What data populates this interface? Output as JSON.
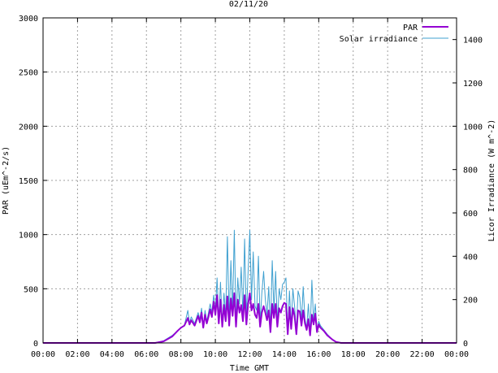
{
  "chart_data": {
    "type": "line",
    "title": "02/11/20",
    "xlabel": "Time GMT",
    "ylabel_left": "PAR (uEm^-2/s)",
    "ylabel_right": "Licor Irradiance (W m^-2)",
    "x_tick_labels": [
      "00:00",
      "02:00",
      "04:00",
      "06:00",
      "08:00",
      "10:00",
      "12:00",
      "14:00",
      "16:00",
      "18:00",
      "20:00",
      "22:00",
      "00:00"
    ],
    "x_range_hours": [
      0,
      24
    ],
    "y_left_range": [
      0,
      3000
    ],
    "y_left_ticks": [
      0,
      500,
      1000,
      1500,
      2000,
      2500,
      3000
    ],
    "y_right_range": [
      0,
      1500
    ],
    "y_right_ticks": [
      0,
      200,
      400,
      600,
      800,
      1000,
      1200,
      1400
    ],
    "grid": true,
    "legend_position": "top-right",
    "series": [
      {
        "name": "PAR",
        "axis": "left",
        "color": "#9400d3",
        "points": [
          [
            0,
            0
          ],
          [
            6.5,
            0
          ],
          [
            7.0,
            15
          ],
          [
            7.5,
            60
          ],
          [
            7.8,
            110
          ],
          [
            8.0,
            140
          ],
          [
            8.2,
            160
          ],
          [
            8.4,
            230
          ],
          [
            8.5,
            170
          ],
          [
            8.6,
            210
          ],
          [
            8.8,
            160
          ],
          [
            9.0,
            250
          ],
          [
            9.1,
            190
          ],
          [
            9.2,
            280
          ],
          [
            9.3,
            140
          ],
          [
            9.4,
            260
          ],
          [
            9.5,
            180
          ],
          [
            9.6,
            240
          ],
          [
            9.7,
            310
          ],
          [
            9.8,
            240
          ],
          [
            9.9,
            380
          ],
          [
            10.0,
            260
          ],
          [
            10.1,
            440
          ],
          [
            10.2,
            180
          ],
          [
            10.3,
            400
          ],
          [
            10.4,
            150
          ],
          [
            10.5,
            350
          ],
          [
            10.6,
            200
          ],
          [
            10.7,
            430
          ],
          [
            10.8,
            160
          ],
          [
            10.9,
            410
          ],
          [
            11.0,
            250
          ],
          [
            11.1,
            460
          ],
          [
            11.2,
            150
          ],
          [
            11.3,
            400
          ],
          [
            11.4,
            280
          ],
          [
            11.5,
            350
          ],
          [
            11.6,
            200
          ],
          [
            11.7,
            440
          ],
          [
            11.8,
            170
          ],
          [
            11.9,
            360
          ],
          [
            12.0,
            460
          ],
          [
            12.1,
            300
          ],
          [
            12.2,
            360
          ],
          [
            12.3,
            260
          ],
          [
            12.4,
            230
          ],
          [
            12.5,
            360
          ],
          [
            12.6,
            150
          ],
          [
            12.7,
            280
          ],
          [
            12.8,
            340
          ],
          [
            12.9,
            280
          ],
          [
            13.0,
            210
          ],
          [
            13.1,
            300
          ],
          [
            13.2,
            100
          ],
          [
            13.3,
            360
          ],
          [
            13.4,
            230
          ],
          [
            13.5,
            360
          ],
          [
            13.6,
            150
          ],
          [
            13.7,
            320
          ],
          [
            13.8,
            280
          ],
          [
            13.9,
            340
          ],
          [
            14.0,
            370
          ],
          [
            14.1,
            360
          ],
          [
            14.2,
            80
          ],
          [
            14.3,
            330
          ],
          [
            14.4,
            130
          ],
          [
            14.5,
            320
          ],
          [
            14.6,
            250
          ],
          [
            14.7,
            80
          ],
          [
            14.8,
            300
          ],
          [
            14.9,
            290
          ],
          [
            15.0,
            160
          ],
          [
            15.1,
            300
          ],
          [
            15.2,
            180
          ],
          [
            15.3,
            120
          ],
          [
            15.4,
            220
          ],
          [
            15.5,
            70
          ],
          [
            15.6,
            260
          ],
          [
            15.7,
            170
          ],
          [
            15.8,
            270
          ],
          [
            15.9,
            100
          ],
          [
            16.0,
            170
          ],
          [
            16.1,
            140
          ],
          [
            16.3,
            110
          ],
          [
            16.5,
            70
          ],
          [
            16.8,
            30
          ],
          [
            17.0,
            10
          ],
          [
            17.3,
            0
          ],
          [
            24,
            0
          ]
        ]
      },
      {
        "name": "Solar irradiance",
        "axis": "right",
        "color": "#3fa0d0",
        "points": [
          [
            0,
            0
          ],
          [
            6.5,
            0
          ],
          [
            7.0,
            10
          ],
          [
            7.5,
            35
          ],
          [
            7.8,
            55
          ],
          [
            8.0,
            70
          ],
          [
            8.2,
            80
          ],
          [
            8.4,
            150
          ],
          [
            8.5,
            90
          ],
          [
            8.6,
            120
          ],
          [
            8.8,
            90
          ],
          [
            9.0,
            140
          ],
          [
            9.1,
            110
          ],
          [
            9.2,
            160
          ],
          [
            9.3,
            80
          ],
          [
            9.4,
            150
          ],
          [
            9.5,
            100
          ],
          [
            9.6,
            140
          ],
          [
            9.7,
            180
          ],
          [
            9.8,
            140
          ],
          [
            9.9,
            220
          ],
          [
            10.0,
            150
          ],
          [
            10.1,
            300
          ],
          [
            10.2,
            100
          ],
          [
            10.3,
            280
          ],
          [
            10.4,
            90
          ],
          [
            10.5,
            230
          ],
          [
            10.6,
            120
          ],
          [
            10.7,
            490
          ],
          [
            10.8,
            100
          ],
          [
            10.9,
            380
          ],
          [
            11.0,
            140
          ],
          [
            11.1,
            520
          ],
          [
            11.2,
            90
          ],
          [
            11.3,
            300
          ],
          [
            11.4,
            180
          ],
          [
            11.5,
            350
          ],
          [
            11.6,
            120
          ],
          [
            11.7,
            480
          ],
          [
            11.8,
            110
          ],
          [
            11.9,
            330
          ],
          [
            12.0,
            520
          ],
          [
            12.1,
            200
          ],
          [
            12.2,
            420
          ],
          [
            12.3,
            170
          ],
          [
            12.4,
            150
          ],
          [
            12.5,
            400
          ],
          [
            12.6,
            90
          ],
          [
            12.7,
            230
          ],
          [
            12.8,
            330
          ],
          [
            12.9,
            200
          ],
          [
            13.0,
            130
          ],
          [
            13.1,
            260
          ],
          [
            13.2,
            60
          ],
          [
            13.3,
            380
          ],
          [
            13.4,
            150
          ],
          [
            13.5,
            330
          ],
          [
            13.6,
            90
          ],
          [
            13.7,
            250
          ],
          [
            13.8,
            200
          ],
          [
            13.9,
            270
          ],
          [
            14.0,
            280
          ],
          [
            14.1,
            300
          ],
          [
            14.2,
            50
          ],
          [
            14.3,
            240
          ],
          [
            14.4,
            80
          ],
          [
            14.5,
            250
          ],
          [
            14.6,
            170
          ],
          [
            14.7,
            50
          ],
          [
            14.8,
            240
          ],
          [
            14.9,
            210
          ],
          [
            15.0,
            100
          ],
          [
            15.1,
            260
          ],
          [
            15.2,
            110
          ],
          [
            15.3,
            70
          ],
          [
            15.4,
            180
          ],
          [
            15.5,
            40
          ],
          [
            15.6,
            290
          ],
          [
            15.7,
            100
          ],
          [
            15.8,
            180
          ],
          [
            15.9,
            60
          ],
          [
            16.0,
            100
          ],
          [
            16.1,
            80
          ],
          [
            16.3,
            60
          ],
          [
            16.5,
            40
          ],
          [
            16.8,
            15
          ],
          [
            17.0,
            5
          ],
          [
            17.3,
            0
          ],
          [
            24,
            0
          ]
        ]
      }
    ]
  }
}
